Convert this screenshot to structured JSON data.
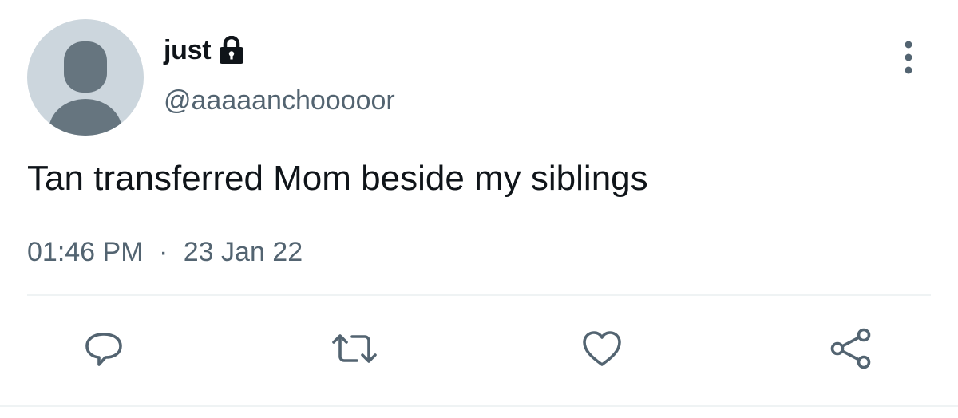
{
  "user": {
    "display_name": "just",
    "handle": "@aaaaanchooooor",
    "protected_icon": "lock-icon",
    "avatar_icon": "default-avatar-icon"
  },
  "tweet": {
    "text": "Tan transferred Mom beside my siblings",
    "time": "01:46 PM",
    "separator": "·",
    "date": "23 Jan 22"
  },
  "actions": [
    {
      "name": "reply",
      "icon": "reply-icon"
    },
    {
      "name": "retweet",
      "icon": "retweet-icon"
    },
    {
      "name": "like",
      "icon": "heart-icon"
    },
    {
      "name": "share",
      "icon": "share-icon"
    }
  ],
  "menu": {
    "icon": "more-vertical-icon"
  },
  "colors": {
    "primary_text": "#0f1419",
    "secondary_text": "#536471",
    "icon": "#536471",
    "avatar_bg": "#ccd6dd",
    "avatar_figure": "#66757f",
    "divider": "#eff3f4"
  }
}
